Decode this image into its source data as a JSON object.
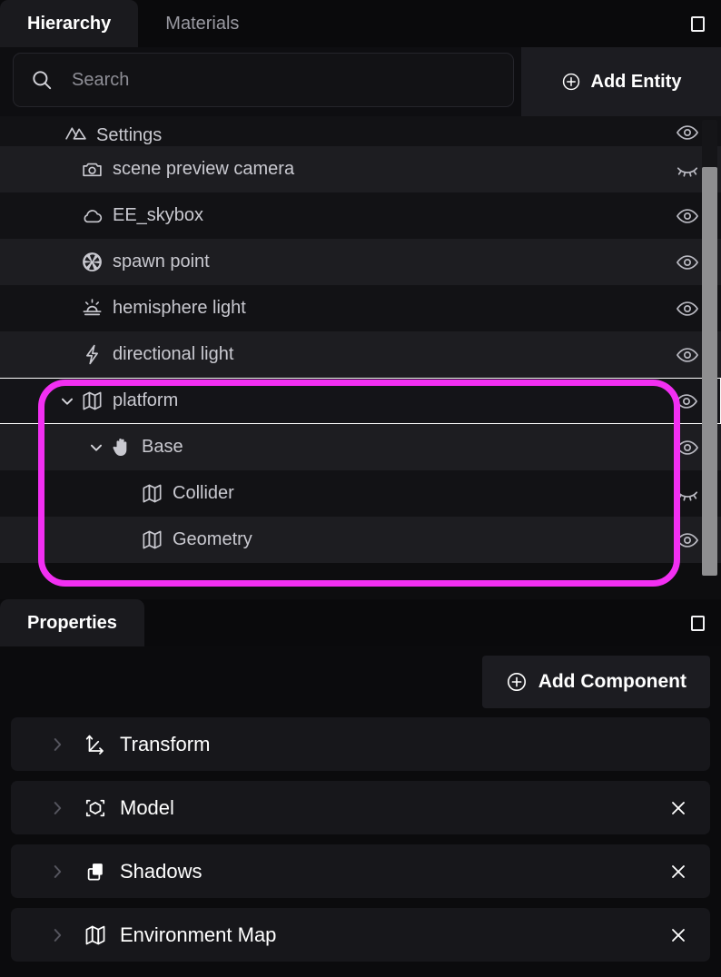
{
  "hierarchy_panel": {
    "tabs": [
      {
        "label": "Hierarchy",
        "active": true
      },
      {
        "label": "Materials",
        "active": false
      }
    ],
    "panel_toggle_icon": "panel-layout-icon",
    "search": {
      "placeholder": "Search",
      "value": "",
      "icon": "search-icon"
    },
    "add_entity": {
      "label": "Add Entity",
      "icon": "plus-circle-icon"
    },
    "entities": [
      {
        "label": "Settings",
        "icon": "mountains-icon",
        "indent": 0,
        "expandable": false,
        "expanded": false,
        "visible": true,
        "selected": false,
        "stripe": "even",
        "clipped": true
      },
      {
        "label": "scene preview camera",
        "icon": "camera-icon",
        "indent": 1,
        "expandable": false,
        "expanded": false,
        "visible": false,
        "selected": false,
        "stripe": "odd",
        "clipped": false
      },
      {
        "label": "EE_skybox",
        "icon": "cloud-icon",
        "indent": 1,
        "expandable": false,
        "expanded": false,
        "visible": true,
        "selected": false,
        "stripe": "even",
        "clipped": false
      },
      {
        "label": "spawn point",
        "icon": "aperture-icon",
        "indent": 1,
        "expandable": false,
        "expanded": false,
        "visible": true,
        "selected": false,
        "stripe": "odd",
        "clipped": false
      },
      {
        "label": "hemisphere light",
        "icon": "sunrise-icon",
        "indent": 1,
        "expandable": false,
        "expanded": false,
        "visible": true,
        "selected": false,
        "stripe": "even",
        "clipped": false
      },
      {
        "label": "directional light",
        "icon": "lightning-icon",
        "indent": 1,
        "expandable": false,
        "expanded": false,
        "visible": true,
        "selected": false,
        "stripe": "odd",
        "clipped": false
      },
      {
        "label": "platform",
        "icon": "map-icon",
        "indent": 1,
        "expandable": true,
        "expanded": true,
        "visible": true,
        "selected": true,
        "stripe": "even",
        "clipped": false
      },
      {
        "label": "Base",
        "icon": "hand-icon",
        "indent": 2,
        "expandable": true,
        "expanded": true,
        "visible": true,
        "selected": false,
        "stripe": "odd",
        "clipped": false
      },
      {
        "label": "Collider",
        "icon": "map-icon",
        "indent": 3,
        "expandable": false,
        "expanded": false,
        "visible": false,
        "selected": false,
        "stripe": "even",
        "clipped": false
      },
      {
        "label": "Geometry",
        "icon": "map-icon",
        "indent": 3,
        "expandable": false,
        "expanded": false,
        "visible": true,
        "selected": false,
        "stripe": "odd",
        "clipped": false
      }
    ],
    "annotation": {
      "color": "#f22ff2",
      "shape": "rounded-rectangle-highlight"
    }
  },
  "properties_panel": {
    "tabs": [
      {
        "label": "Properties",
        "active": true
      }
    ],
    "panel_toggle_icon": "panel-layout-icon",
    "add_component": {
      "label": "Add Component",
      "icon": "plus-circle-icon"
    },
    "components": [
      {
        "label": "Transform",
        "icon": "axes-gizmo-icon",
        "expanded": false,
        "removable": false
      },
      {
        "label": "Model",
        "icon": "cube-3d-icon",
        "expanded": false,
        "removable": true
      },
      {
        "label": "Shadows",
        "icon": "shadow-icon",
        "expanded": false,
        "removable": true
      },
      {
        "label": "Environment Map",
        "icon": "map-icon",
        "expanded": false,
        "removable": true
      }
    ],
    "remove_label": "×"
  },
  "colors": {
    "background": "#0b0b0d",
    "row_even": "#121215",
    "row_odd": "#1d1d21",
    "accent_annotation": "#f22ff2",
    "text_primary": "#ffffff",
    "text_secondary": "#c9c9d0",
    "text_muted": "#8e8e96"
  }
}
